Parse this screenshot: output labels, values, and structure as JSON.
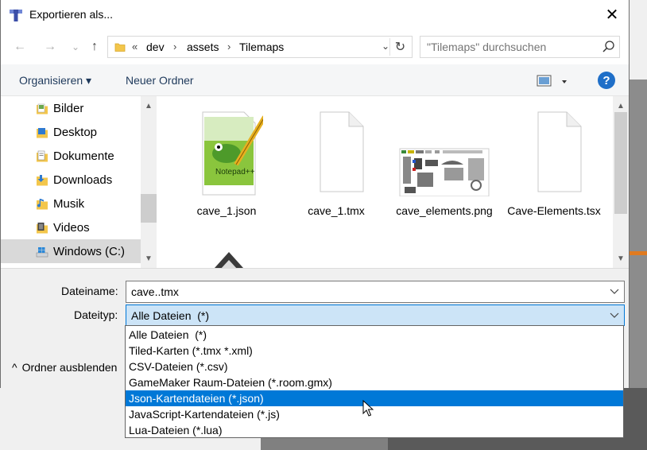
{
  "window": {
    "title": "Exportieren als...",
    "close_glyph": "✕"
  },
  "navigation": {
    "back_glyph": "←",
    "forward_glyph": "→",
    "recent_glyph": "⌄",
    "up_glyph": "↑",
    "breadcrumb": [
      "dev",
      "assets",
      "Tilemaps"
    ],
    "overflow_glyph": "«",
    "separator_glyph": "›",
    "refresh_glyph": "↻",
    "search_placeholder": "\"Tilemaps\" durchsuchen"
  },
  "toolbar": {
    "organize_label": "Organisieren ▾",
    "new_folder_label": "Neuer Ordner",
    "help_glyph": "?"
  },
  "sidebar": {
    "items": [
      {
        "label": "Bilder",
        "icon": "pictures-folder-icon"
      },
      {
        "label": "Desktop",
        "icon": "desktop-folder-icon"
      },
      {
        "label": "Dokumente",
        "icon": "documents-folder-icon"
      },
      {
        "label": "Downloads",
        "icon": "downloads-folder-icon"
      },
      {
        "label": "Musik",
        "icon": "music-folder-icon"
      },
      {
        "label": "Videos",
        "icon": "videos-folder-icon"
      },
      {
        "label": "Windows (C:)",
        "icon": "drive-icon",
        "selected": true
      }
    ]
  },
  "files": [
    {
      "name": "cave_1.json",
      "icon": "notepad-plus-plus-file-icon"
    },
    {
      "name": "cave_1.tmx",
      "icon": "blank-document-icon"
    },
    {
      "name": "cave_elements.png",
      "icon": "image-thumbnail"
    },
    {
      "name": "Cave-Elements.tsx",
      "icon": "blank-document-icon"
    },
    {
      "name": "",
      "icon": "partial-file-icon"
    }
  ],
  "form": {
    "filename_label": "Dateiname:",
    "filename_value": "cave..tmx",
    "filetype_label": "Dateityp:",
    "filetype_value": "Alle Dateien  (*)",
    "hide_folders_label": "Ordner ausblenden",
    "hide_folders_glyph": "^"
  },
  "filetype_options": [
    {
      "label": "Alle Dateien  (*)"
    },
    {
      "label": "Tiled-Karten (*.tmx *.xml)"
    },
    {
      "label": "CSV-Dateien (*.csv)"
    },
    {
      "label": "GameMaker Raum-Dateien (*.room.gmx)"
    },
    {
      "label": "Json-Kartendateien (*.json)",
      "highlighted": true
    },
    {
      "label": "JavaScript-Kartendateien (*.js)"
    },
    {
      "label": "Lua-Dateien (*.lua)"
    }
  ],
  "colors": {
    "accent": "#0078d7",
    "selected_field": "#cce4f7",
    "help_blue": "#1f6fc8"
  }
}
